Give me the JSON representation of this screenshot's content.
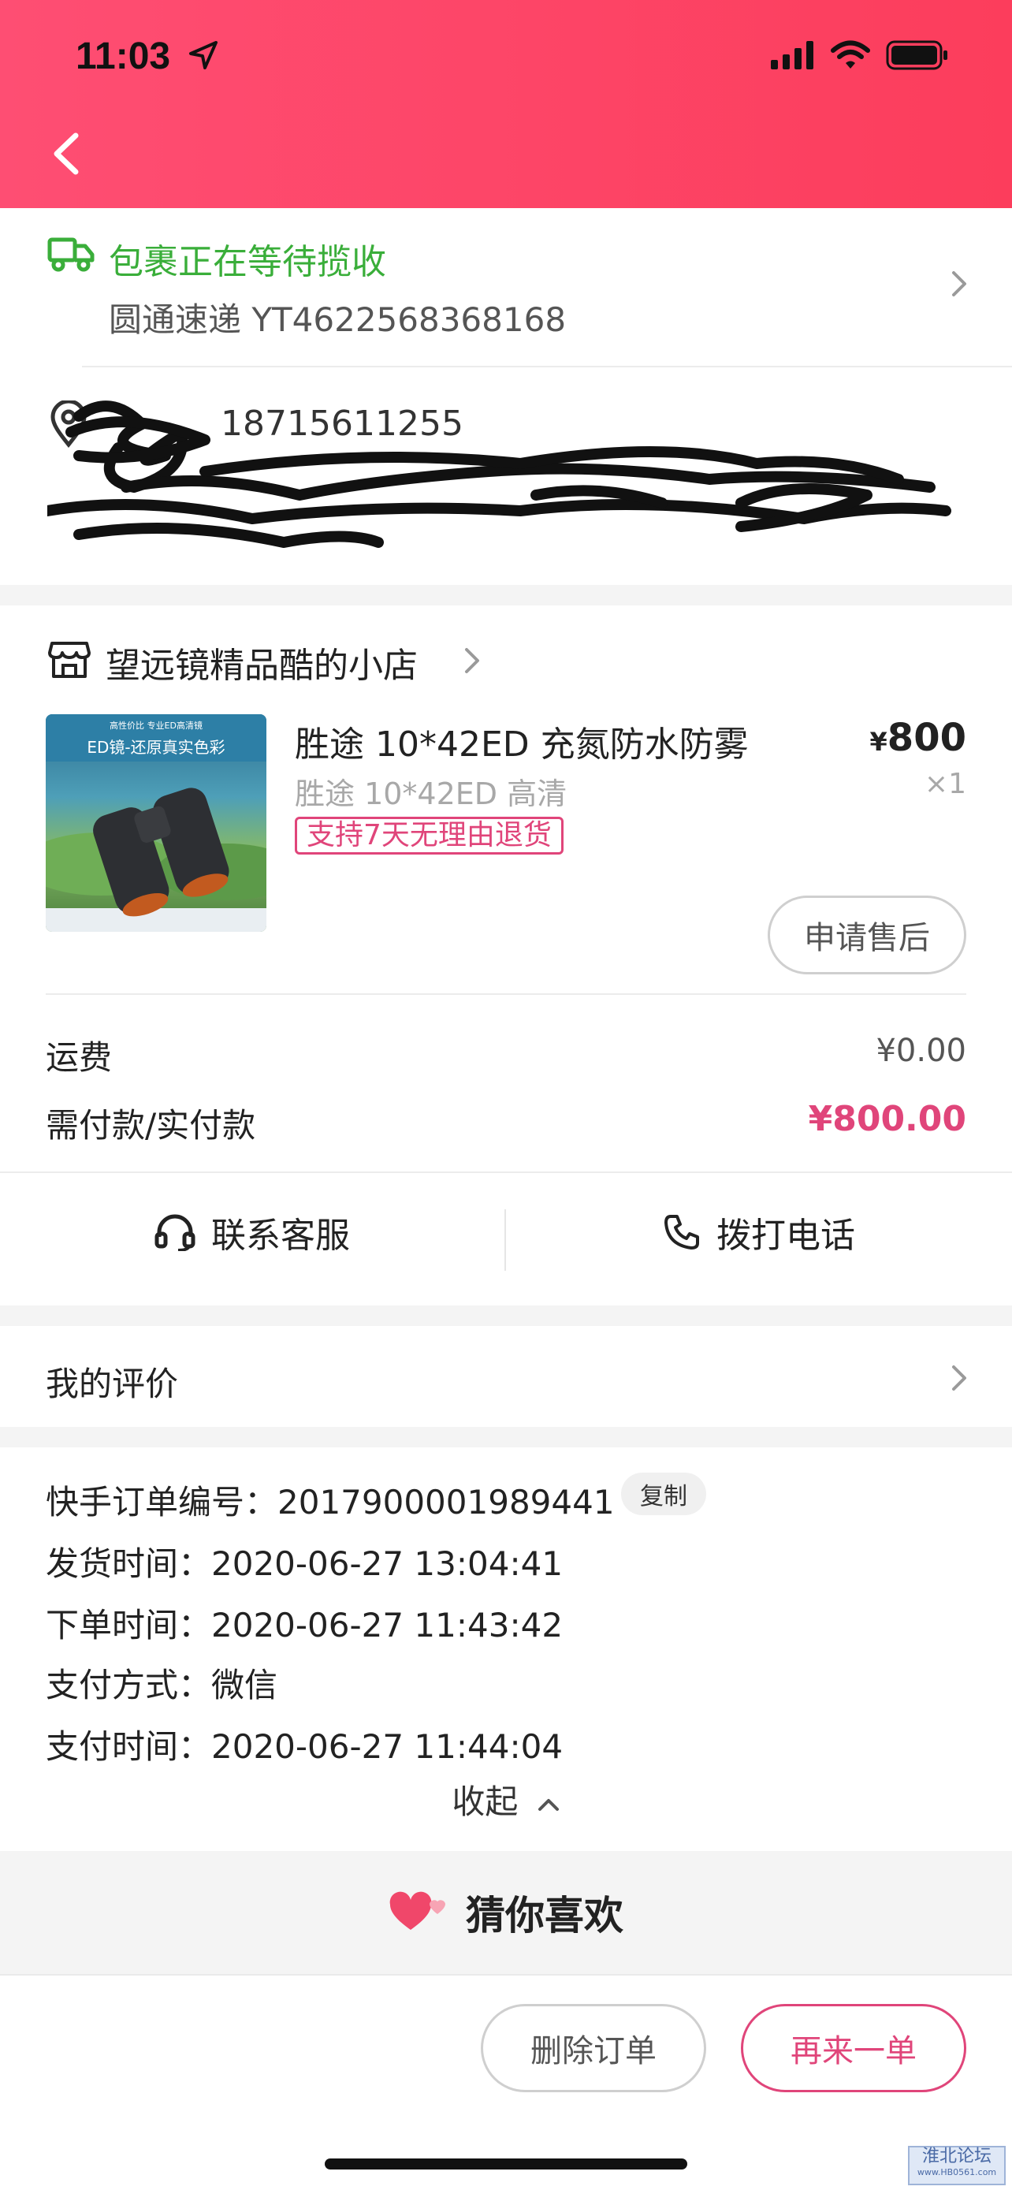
{
  "status_bar": {
    "time": "11:03"
  },
  "shipping": {
    "status": "包裹正在等待揽收",
    "courier": "圆通速递 YT4622568368168",
    "color": "#3aae3a"
  },
  "address": {
    "phone": "18715611255"
  },
  "shop": {
    "name": "望远镜精品酷的小店"
  },
  "product": {
    "title": "胜途 10*42ED 充氮防水防雾",
    "spec": "胜途 10*42ED 高清",
    "tag": "支持7天无理由退货",
    "currency": "¥",
    "price": "800",
    "qty": "×1",
    "image_text_1": "高性价比 专业ED高清镜",
    "image_text_2": "ED镜-还原真实色彩",
    "after_sale": "申请售后"
  },
  "fees": {
    "shipping_label": "运费",
    "shipping_value": "¥0.00",
    "paid_label": "需付款/实付款",
    "paid_value": "¥800.00"
  },
  "contact": {
    "service": "联系客服",
    "call": "拨打电话"
  },
  "review": {
    "label": "我的评价"
  },
  "order_info": {
    "order_no": "快手订单编号：2017900001989441",
    "copy": "复制",
    "ship_time": "发货时间：2020-06-27 13:04:41",
    "order_time": "下单时间：2020-06-27 11:43:42",
    "pay_method": "支付方式：微信",
    "pay_time": "支付时间：2020-06-27 11:44:04",
    "collapse": "收起"
  },
  "recommend": {
    "title": "猜你喜欢"
  },
  "actions": {
    "delete": "删除订单",
    "reorder": "再来一单"
  },
  "watermark": {
    "text": "淮北论坛",
    "sub": "www.HB0561.com"
  },
  "colors": {
    "accent": "#fe4e73",
    "price_red": "#e0457a",
    "green": "#3aae3a"
  }
}
